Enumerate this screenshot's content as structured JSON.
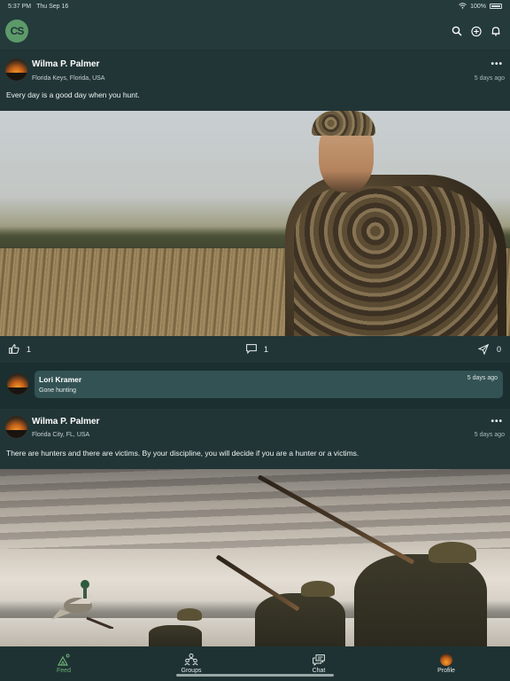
{
  "status_bar": {
    "time": "5:37 PM",
    "date": "Thu Sep 16",
    "battery": "100%"
  },
  "header": {
    "logo_text": "CS",
    "actions": [
      {
        "icon": "search-icon"
      },
      {
        "icon": "add-circle-icon"
      },
      {
        "icon": "bell-icon"
      }
    ]
  },
  "posts": [
    {
      "author": "Wilma P. Palmer",
      "location": "Florida Keys, Florida, USA",
      "time": "5 days ago",
      "more": "•••",
      "text": "Every day is a good day when you hunt.",
      "likes": "1",
      "comments": "1",
      "shares": "0",
      "comment": {
        "author": "Lori Kramer",
        "time": "5 days ago",
        "text": "Gone hunting"
      }
    },
    {
      "author": "Wilma P. Palmer",
      "location": "Florida City, FL, USA",
      "time": "5 days ago",
      "more": "•••",
      "text": "There are hunters and there are victims. By your discipline, you will decide if you are a hunter or a victims."
    }
  ],
  "tabs": [
    {
      "label": "Feed",
      "icon": "feed-icon",
      "active": true
    },
    {
      "label": "Groups",
      "icon": "groups-icon",
      "active": false
    },
    {
      "label": "Chat",
      "icon": "chat-icon",
      "active": false
    },
    {
      "label": "Profile",
      "icon": "profile-avatar-icon",
      "active": false
    }
  ],
  "colors": {
    "accent": "#6aae74",
    "background": "#1b2f30",
    "card": "#223536",
    "comment_bubble": "#335253"
  }
}
